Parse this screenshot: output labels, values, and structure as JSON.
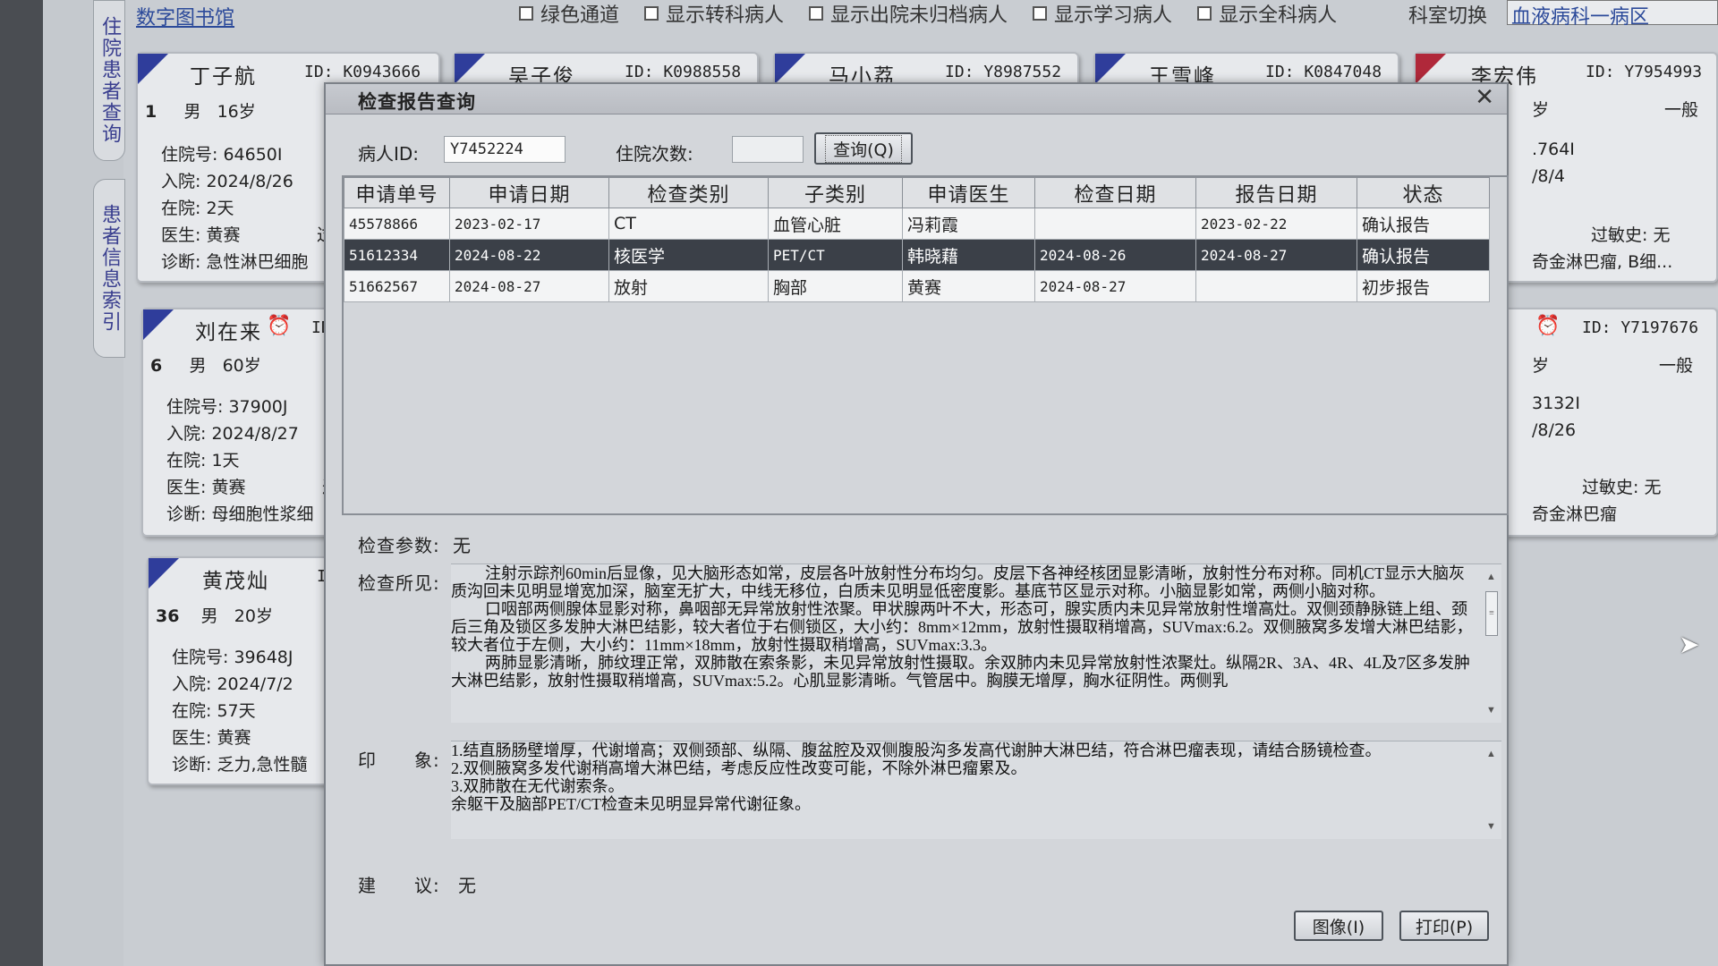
{
  "topbar": {
    "library_link": "数字图书馆",
    "checkboxes": [
      "绿色通道",
      "显示转科病人",
      "显示出院未归档病人",
      "显示学习病人",
      "显示全科病人"
    ],
    "ward_switch_label": "科室切换",
    "ward_value": "血液病科一病区"
  },
  "side_tabs": {
    "tab1": "住院患者查询",
    "tab2": "患者信息索引"
  },
  "cards": [
    {
      "name": "丁子航",
      "id": "ID: K0943666",
      "bed": "1",
      "sex": "男",
      "age": "16岁",
      "admission_no": "住院号: 64650I",
      "admit_date": "入院: 2024/8/26",
      "stay": "在院: 2天",
      "doctor": "医生: 黄赛",
      "diagnosis": "诊断: 急性淋巴细胞"
    },
    {
      "name": "吴子俊",
      "id": "ID: K0988558"
    },
    {
      "name": "马小荔",
      "id": "ID: Y8987552"
    },
    {
      "name": "王雪峰",
      "id": "ID: K0847048"
    },
    {
      "name": "李宏伟",
      "id": "ID: Y7954993",
      "age_partial": "岁",
      "level": "一般",
      "admission_partial": ".764I",
      "admit_partial": "/8/4",
      "allergy": "过敏史: 无",
      "diagnosis_partial": "奇金淋巴瘤, B细..."
    },
    {
      "name": "刘在来",
      "id": "ID",
      "bed": "6",
      "sex": "男",
      "age": "60岁",
      "admission_no": "住院号: 37900J",
      "admit_date": "入院: 2024/8/27",
      "stay": "在院: 1天",
      "doctor": "医生: 黄赛",
      "diagnosis": "诊断: 母细胞性浆细"
    },
    {
      "name": "",
      "id": "ID: Y7197676",
      "age_partial": "岁",
      "level": "一般",
      "admission_partial": "3132I",
      "admit_partial": "/8/26",
      "allergy": "过敏史: 无",
      "diagnosis_partial": "奇金淋巴瘤"
    },
    {
      "name": "黄茂灿",
      "id": "ID",
      "bed": "36",
      "sex": "男",
      "age": "20岁",
      "admission_no": "住院号: 39648J",
      "admit_date": "入院: 2024/7/2",
      "stay": "在院: 57天",
      "doctor": "医生: 黄赛",
      "diagnosis": "诊断: 乏力,急性髓"
    }
  ],
  "card_extra": {
    "doctor_suffix": "过"
  },
  "dialog": {
    "title": "检查报告查询",
    "patient_id_label": "病人ID:",
    "patient_id_value": "Y7452224",
    "visit_count_label": "住院次数:",
    "visit_count_value": "",
    "query_button": "查询(Q)",
    "table": {
      "headers": [
        "申请单号",
        "申请日期",
        "检查类别",
        "子类别",
        "申请医生",
        "检查日期",
        "报告日期",
        "状态"
      ],
      "rows": [
        [
          "45578866",
          "2023-02-17",
          "CT",
          "血管心脏",
          "冯莉霞",
          "",
          "2023-02-22",
          "确认报告"
        ],
        [
          "51612334",
          "2024-08-22",
          "核医学",
          "PET/CT",
          "韩晓藉",
          "2024-08-26",
          "2024-08-27",
          "确认报告"
        ],
        [
          "51662567",
          "2024-08-27",
          "放射",
          "胸部",
          "黄赛",
          "2024-08-27",
          "",
          "初步报告"
        ]
      ],
      "selected_row": 1
    },
    "params_label": "检查参数:",
    "params_value": "无",
    "findings_label": "检查所见:",
    "findings": [
      "注射示踪剂60min后显像，见大脑形态如常，皮层各叶放射性分布均匀。皮层下各神经核团显影清晰，放射性分布对称。同机CT显示大脑灰质沟回未见明显增宽加深，脑室无扩大，中线无移位，白质未见明显低密度影。基底节区显示对称。小脑显影如常，两侧小脑对称。",
      "口咽部两侧腺体显影对称，鼻咽部无异常放射性浓聚。甲状腺两叶不大，形态可，腺实质内未见异常放射性增高灶。双侧颈静脉链上组、颈后三角及锁区多发肿大淋巴结影，较大者位于右侧锁区，大小约：8mm×12mm，放射性摄取稍增高，SUVmax:6.2。双侧腋窝多发增大淋巴结影，较大者位于左侧，大小约：11mm×18mm，放射性摄取稍增高，SUVmax:3.3。",
      "两肺显影清晰，肺纹理正常，双肺散在索条影，未见异常放射性摄取。余双肺内未见异常放射性浓聚灶。纵隔2R、3A、4R、4L及7区多发肿大淋巴结影，放射性摄取稍增高，SUVmax:5.2。心肌显影清晰。气管居中。胸膜无增厚，胸水征阴性。两侧乳"
    ],
    "impression_label": "印　　象:",
    "impression": [
      "1.结直肠肠壁增厚，代谢增高；双侧颈部、纵隔、腹盆腔及双侧腹股沟多发高代谢肿大淋巴结，符合淋巴瘤表现，请结合肠镜检查。",
      "2.双侧腋窝多发代谢稍高增大淋巴结，考虑反应性改变可能，不除外淋巴瘤累及。",
      "3.双肺散在无代谢索条。",
      "余躯干及脑部PET/CT检查未见明显异常代谢征象。"
    ],
    "advice_label": "建　　议:",
    "advice_value": "无",
    "image_button": "图像(I)",
    "print_button": "打印(P)"
  }
}
